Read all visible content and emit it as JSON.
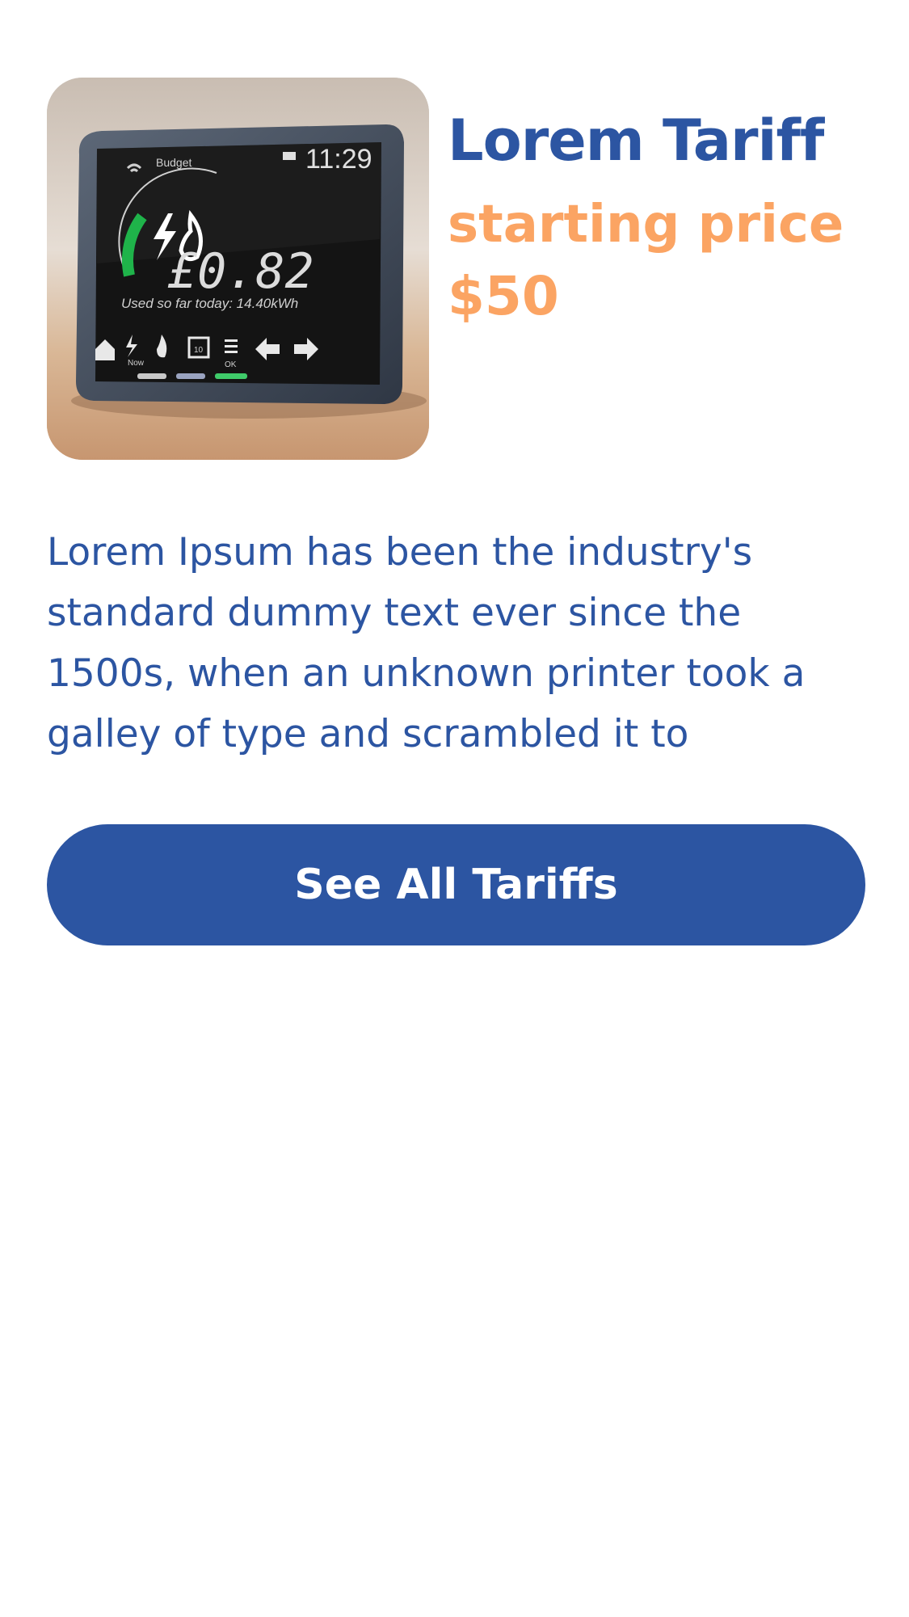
{
  "product": {
    "title": "Lorem Tariff",
    "price_label": "starting price",
    "price_value": "$50",
    "image": {
      "icon": "smart-energy-meter",
      "screen_label_budget": "Budget",
      "screen_time": "11:29",
      "screen_amount": "£0.82",
      "screen_usage": "Used so far today: 14.40kWh",
      "screen_now": "Now",
      "screen_ok": "OK",
      "screen_calendar": "10"
    }
  },
  "description": "Lorem Ipsum has been the industry's standard dummy text ever since the 1500s, when an unknown printer took a galley of type and scrambled it to",
  "cta": {
    "label": "See All Tariffs"
  },
  "colors": {
    "primary": "#2c55a2",
    "accent": "#fba463",
    "background": "#ffffff"
  }
}
